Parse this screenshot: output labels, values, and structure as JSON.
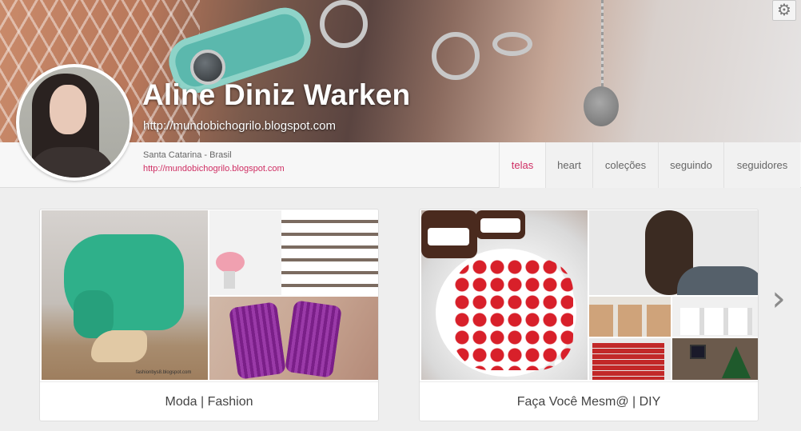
{
  "profile": {
    "name": "Aline Diniz Warken",
    "url": "http://mundobichogrilo.blogspot.com",
    "location": "Santa Catarina - Brasil",
    "website": "http://mundobichogrilo.blogspot.com"
  },
  "tabs": [
    {
      "label": "telas",
      "active": true
    },
    {
      "label": "heart",
      "active": false
    },
    {
      "label": "coleções",
      "active": false
    },
    {
      "label": "seguindo",
      "active": false
    },
    {
      "label": "seguidores",
      "active": false
    }
  ],
  "boards": [
    {
      "title": "Moda | Fashion",
      "watermark": "fashionbys8.blogspot.com"
    },
    {
      "title": "Faça Você Mesm@ | DIY"
    }
  ],
  "icons": {
    "settings": "gear-icon",
    "next": "chevron-right-icon"
  },
  "colors": {
    "accent": "#cf2e63",
    "background": "#eeeeee"
  }
}
